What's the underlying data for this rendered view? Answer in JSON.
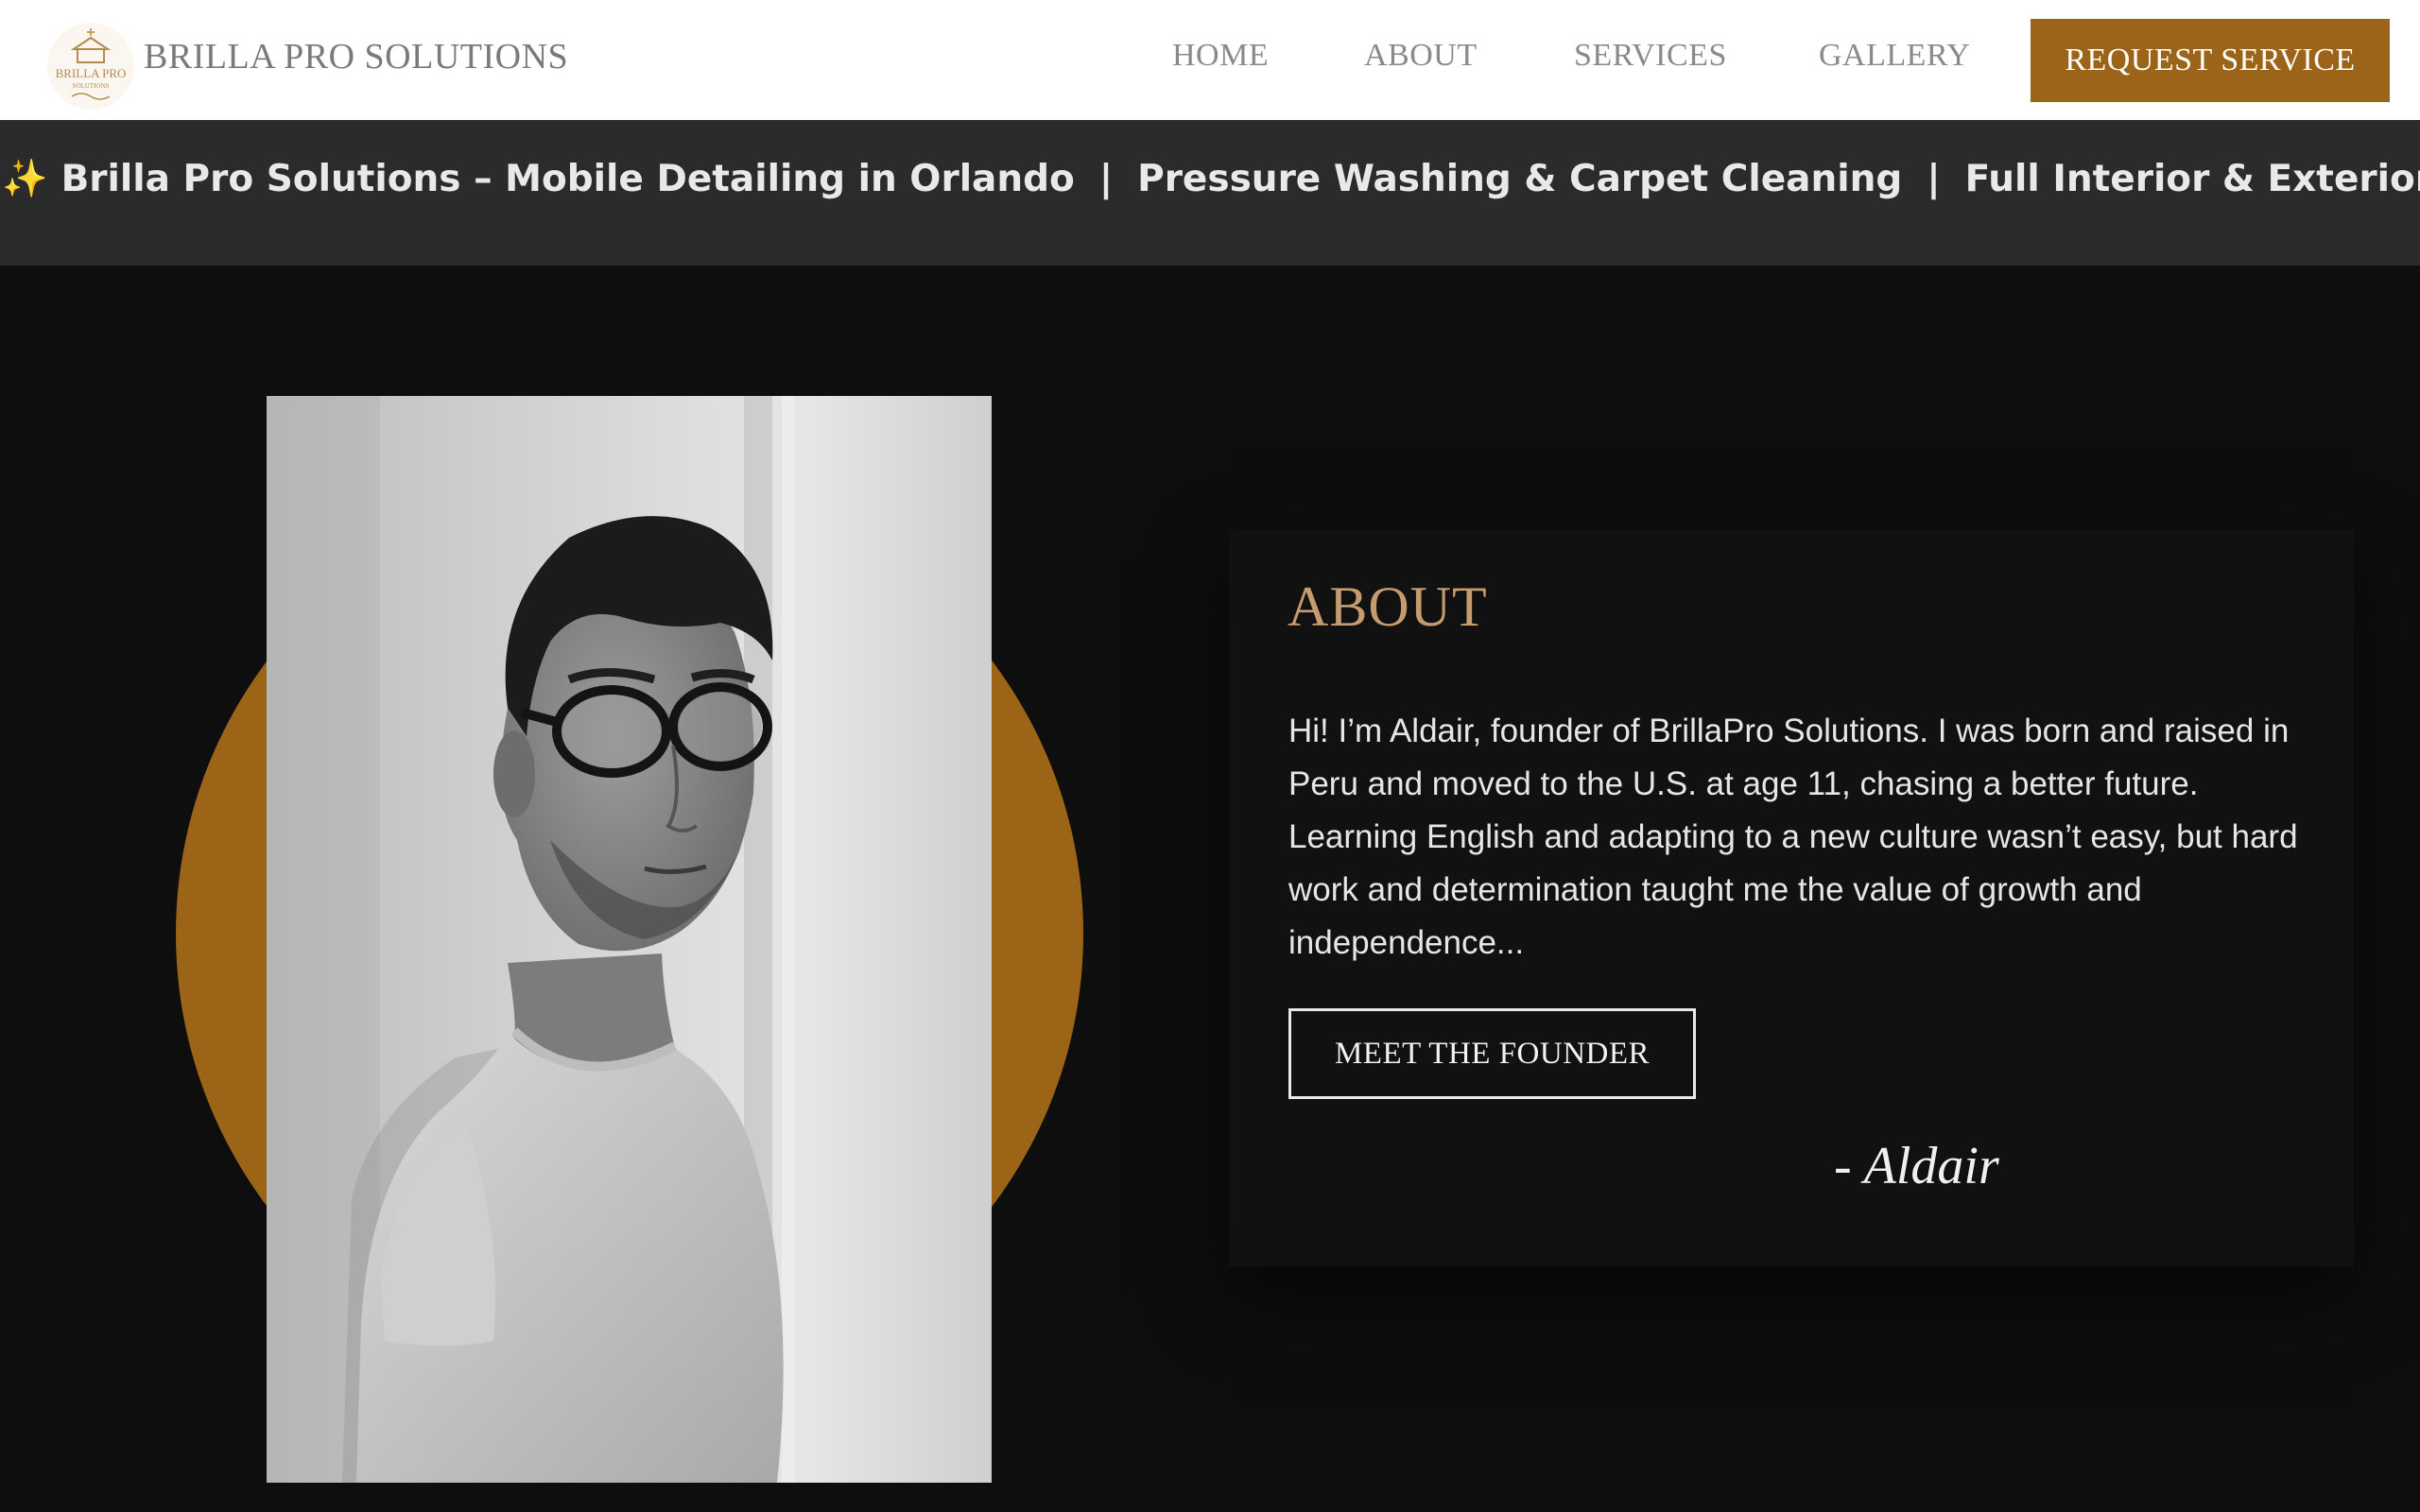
{
  "header": {
    "brand_name": "BRILLA PRO SOLUTIONS",
    "logo_text": "BRILLA PRO",
    "logo_subtext": "SOLUTIONS",
    "nav": [
      {
        "label": "HOME"
      },
      {
        "label": "ABOUT"
      },
      {
        "label": "SERVICES"
      },
      {
        "label": "GALLERY"
      }
    ],
    "cta_label": "REQUEST SERVICE"
  },
  "ticker": {
    "sparkle": "✨",
    "items": [
      "Brilla Pro Solutions – Mobile Detailing in Orlando",
      "Pressure Washing & Carpet Cleaning",
      "Full Interior & Exterior Detail – Bo"
    ],
    "separator": "|"
  },
  "about": {
    "heading": "ABOUT",
    "text": "Hi! I’m Aldair, founder of BrillaPro Solutions. I was born and raised in Peru and moved to the U.S. at age 11, chasing a better future. Learning English and adapting to a new culture wasn’t easy, but hard work and determination taught me the value of growth and independence...",
    "button_label": "MEET THE FOUNDER",
    "signature": "- Aldair"
  },
  "colors": {
    "accent": "#9b6418",
    "heading_tan": "#c69b6d",
    "ticker_bg": "#2b2b2c",
    "page_bg": "#0e0e0e"
  }
}
